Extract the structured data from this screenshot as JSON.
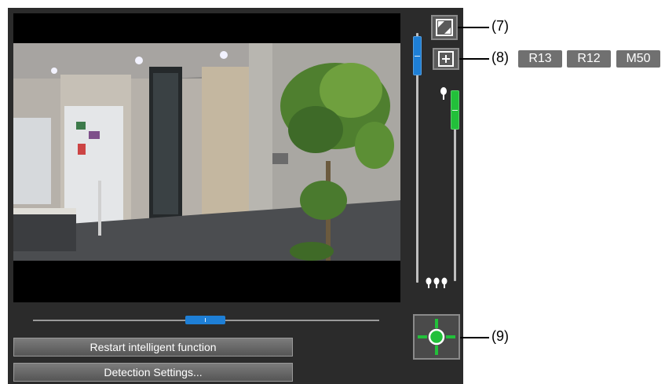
{
  "controls": {
    "restart_label": "Restart intelligent function",
    "detection_label": "Detection Settings..."
  },
  "callouts": {
    "c7": "(7)",
    "c8": "(8)",
    "c9": "(9)"
  },
  "badges": [
    "R13",
    "R12",
    "M50"
  ],
  "sliders": {
    "zoom_level": 0.06,
    "focus_level": 0.12,
    "pan_position": 0.5
  },
  "colors": {
    "zoom_thumb": "#1e7fd6",
    "focus_thumb": "#22c03a",
    "pan_thumb": "#1e7fd6",
    "center_dot": "#22c03a"
  },
  "icons": {
    "fullscreen": "fullscreen-toggle-icon",
    "zoom_in": "plus-icon",
    "focus_near": "single-tree-icon",
    "focus_far": "three-trees-icon",
    "home": "crosshair-center-icon"
  }
}
